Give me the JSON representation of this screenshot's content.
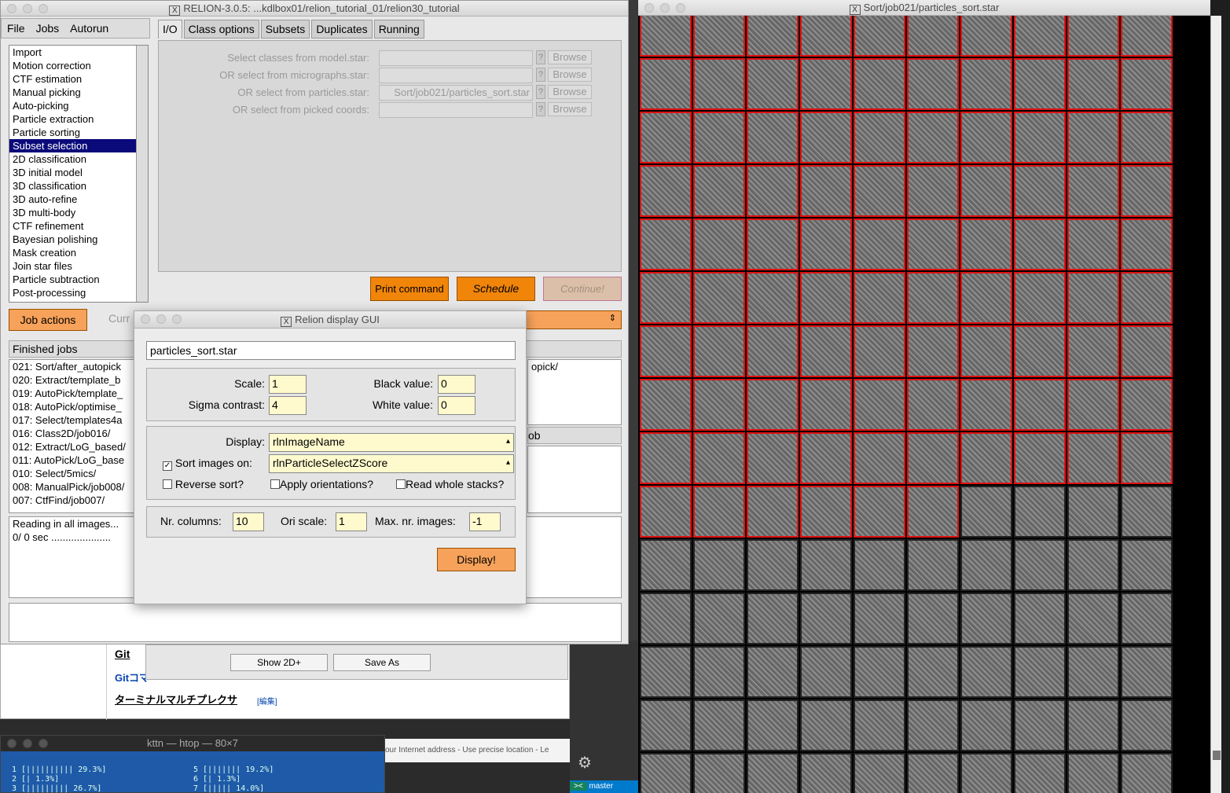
{
  "relion": {
    "title": "RELION-3.0.5: ...kdlbox01/relion_tutorial_01/relion30_tutorial",
    "menu": [
      "File",
      "Jobs",
      "Autorun"
    ],
    "job_types": [
      "Import",
      "Motion correction",
      "CTF estimation",
      "Manual picking",
      "Auto-picking",
      "Particle extraction",
      "Particle sorting",
      "Subset selection",
      "2D classification",
      "3D initial model",
      "3D classification",
      "3D auto-refine",
      "3D multi-body",
      "CTF refinement",
      "Bayesian polishing",
      "Mask creation",
      "Join star files",
      "Particle subtraction",
      "Post-processing"
    ],
    "selected_job_type": "Subset selection",
    "tabs": [
      "I/O",
      "Class options",
      "Subsets",
      "Duplicates",
      "Running"
    ],
    "fields": [
      {
        "label": "Select classes from model.star:",
        "value": ""
      },
      {
        "label": "OR select from micrographs.star:",
        "value": ""
      },
      {
        "label": "OR select from particles.star:",
        "value": "Sort/job021/particles_sort.star"
      },
      {
        "label": "OR select from picked coords:",
        "value": ""
      }
    ],
    "help_label": "?",
    "browse_label": "Browse",
    "print_command": "Print command",
    "schedule": "Schedule",
    "continue": "Continue!",
    "job_actions": "Job actions",
    "current_label": "Curr",
    "finished_jobs_label": "Finished jobs",
    "finished_jobs": [
      "021: Sort/after_autopick",
      "020: Extract/template_b",
      "019: AutoPick/template_",
      "018: AutoPick/optimise_",
      "017: Select/templates4a",
      "016: Class2D/job016/",
      "012: Extract/LoG_based/",
      "011: AutoPick/LoG_base",
      "010: Select/5mics/",
      "008: ManualPick/job008/",
      "007: CtfFind/job007/"
    ],
    "side_text_1": "opick/",
    "side_text_2": "ob",
    "log_lines": [
      "Reading in all images...",
      "   0/   0 sec ....................."
    ]
  },
  "display_gui": {
    "title": "Relion display GUI",
    "filename": "particles_sort.star",
    "scale_label": "Scale:",
    "scale": "1",
    "black_label": "Black value:",
    "black": "0",
    "sigma_label": "Sigma contrast:",
    "sigma": "4",
    "white_label": "White value:",
    "white": "0",
    "display_label": "Display:",
    "display": "rlnImageName",
    "sort_label": "Sort images on:",
    "sort": "rlnParticleSelectZScore",
    "reverse_label": "Reverse sort?",
    "apply_label": "Apply orientations?",
    "read_label": "Read whole stacks?",
    "ncols_label": "Nr. columns:",
    "ncols": "10",
    "ori_label": "Ori scale:",
    "ori": "1",
    "max_label": "Max. nr. images:",
    "max": "-1",
    "display_btn": "Display!"
  },
  "behind": {
    "show2d": "Show 2D+",
    "saveas": "Save As",
    "git": "Git",
    "git_link": "Gitコマ",
    "terminal_heading": "ターミナルマルチプレクサ",
    "edit": "[編集]",
    "location": "our Internet address - Use precise location - Le",
    "branch": "master"
  },
  "particles_window": {
    "title": "Sort/job021/particles_sort.star",
    "columns": 10,
    "rows": 15,
    "selected_count": 96
  },
  "htop": {
    "title": "kttn — htop — 80×7",
    "rows": [
      {
        "left": "1  [||||||||||            29.3%]",
        "right": "5  [|||||||               19.2%]"
      },
      {
        "left": "2  [|                      1.3%]",
        "right": "6  [|                      1.3%]"
      },
      {
        "left": "3  [|||||||||             26.7%]",
        "right": "7  [|||||                 14.0%]"
      }
    ]
  }
}
